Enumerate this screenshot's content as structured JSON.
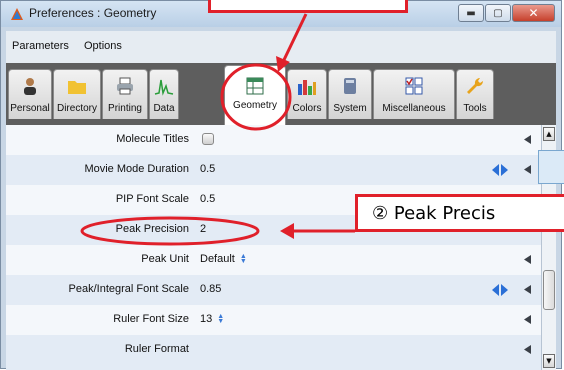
{
  "window": {
    "title": "Preferences : Geometry",
    "minimize_glyph": "▬",
    "maximize_glyph": "▢",
    "close_glyph": "✕"
  },
  "menu": {
    "items": [
      "Parameters",
      "Options"
    ]
  },
  "tabs": [
    {
      "label": "Personal",
      "icon": "person-icon",
      "active": false
    },
    {
      "label": "Directory",
      "icon": "folder-icon",
      "active": false
    },
    {
      "label": "Printing",
      "icon": "printer-icon",
      "active": false
    },
    {
      "label": "Data",
      "icon": "spectrum-icon",
      "active": false
    },
    {
      "label": "Geometry",
      "icon": "grid-icon",
      "active": true
    },
    {
      "label": "Colors",
      "icon": "color-bars-icon",
      "active": false
    },
    {
      "label": "System",
      "icon": "system-icon",
      "active": false
    },
    {
      "label": "Miscellaneous",
      "icon": "checklist-icon",
      "active": false
    },
    {
      "label": "Tools",
      "icon": "wrench-icon",
      "active": false
    }
  ],
  "rows": [
    {
      "label": "Molecule Titles",
      "value": "",
      "control": "checkbox",
      "checked": false,
      "arrows": false
    },
    {
      "label": "Movie Mode Duration",
      "value": "0.5",
      "control": "text",
      "arrows": true
    },
    {
      "label": "PIP Font Scale",
      "value": "0.5",
      "control": "text",
      "arrows": false
    },
    {
      "label": "Peak Precision",
      "value": "2",
      "control": "text",
      "arrows": false
    },
    {
      "label": "Peak Unit",
      "value": "Default",
      "control": "dropdown",
      "arrows": false
    },
    {
      "label": "Peak/Integral Font Scale",
      "value": "0.85",
      "control": "text",
      "arrows": true
    },
    {
      "label": "Ruler Font Size",
      "value": "13",
      "control": "dropdown",
      "arrows": false
    },
    {
      "label": "Ruler Format",
      "value": "",
      "control": "text",
      "arrows": false
    }
  ],
  "annotation": {
    "callout_text": "② Peak Precis",
    "accent_color": "#e0202a"
  },
  "colors": {
    "title_bar": "#c5d8ec",
    "row_alt": "#e3ebf5",
    "annotation_red": "#e0202a",
    "spinner_blue": "#3b7ad6"
  }
}
